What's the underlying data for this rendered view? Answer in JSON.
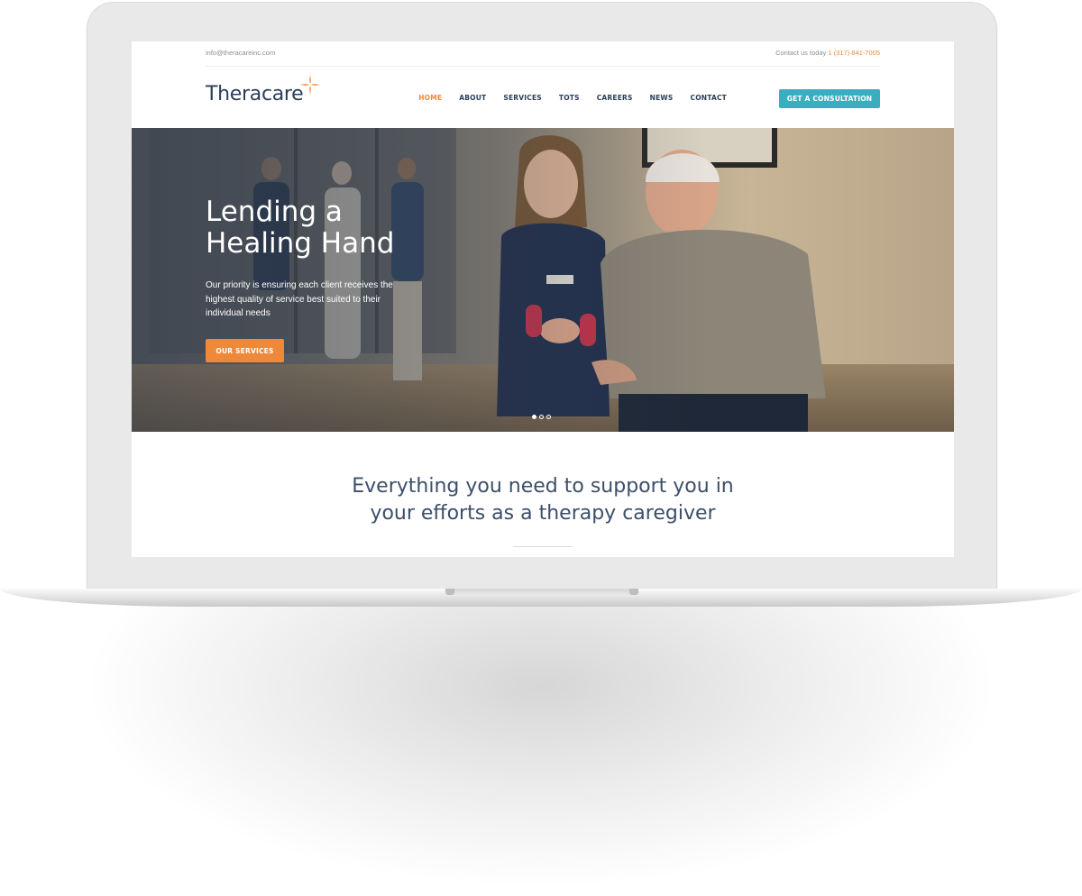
{
  "topbar": {
    "email": "info@theracareinc.com",
    "contact_label": "Contact us today",
    "phone": "1 (317) 841-7005"
  },
  "logo": {
    "text": "Theracare",
    "icon": "cross-logo-icon"
  },
  "nav": {
    "items": [
      {
        "label": "HOME",
        "active": true
      },
      {
        "label": "ABOUT",
        "active": false
      },
      {
        "label": "SERVICES",
        "active": false
      },
      {
        "label": "TOTS",
        "active": false
      },
      {
        "label": "CAREERS",
        "active": false
      },
      {
        "label": "NEWS",
        "active": false
      },
      {
        "label": "CONTACT",
        "active": false
      }
    ],
    "cta_label": "GET A CONSULTATION"
  },
  "hero": {
    "title_line1": "Lending a",
    "title_line2": "Healing Hand",
    "subtitle": "Our priority is ensuring each client receives the highest quality of service best suited to their individual needs",
    "button_label": "OUR SERVICES",
    "slide_count": 3,
    "active_slide": 1
  },
  "section": {
    "title_line1": "Everything you need to support you in",
    "title_line2": "your efforts as a therapy caregiver"
  },
  "colors": {
    "accent_orange": "#f0883a",
    "accent_teal": "#3aaebf",
    "navy": "#2b3e5c"
  }
}
